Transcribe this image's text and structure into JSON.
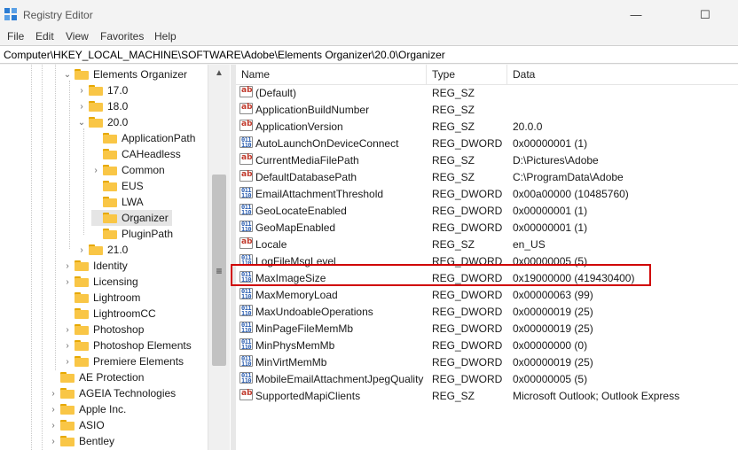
{
  "window": {
    "title": "Registry Editor",
    "controls": [
      "—",
      "☐"
    ]
  },
  "menu": [
    "File",
    "Edit",
    "View",
    "Favorites",
    "Help"
  ],
  "address": "Computer\\HKEY_LOCAL_MACHINE\\SOFTWARE\\Adobe\\Elements Organizer\\20.0\\Organizer",
  "tree": [
    {
      "label": "Elements Organizer",
      "chevron": "⌄"
    },
    {
      "label": "17.0",
      "chevron": "›"
    },
    {
      "label": "18.0",
      "chevron": "›"
    },
    {
      "label": "20.0",
      "chevron": "⌄"
    },
    {
      "label": "ApplicationPath",
      "chevron": ""
    },
    {
      "label": "CAHeadless",
      "chevron": ""
    },
    {
      "label": "Common",
      "chevron": "›"
    },
    {
      "label": "EUS",
      "chevron": ""
    },
    {
      "label": "LWA",
      "chevron": ""
    },
    {
      "label": "Organizer",
      "chevron": ""
    },
    {
      "label": "PluginPath",
      "chevron": ""
    },
    {
      "label": "21.0",
      "chevron": "›"
    },
    {
      "label": "Identity",
      "chevron": "›"
    },
    {
      "label": "Licensing",
      "chevron": "›"
    },
    {
      "label": "Lightroom",
      "chevron": ""
    },
    {
      "label": "LightroomCC",
      "chevron": ""
    },
    {
      "label": "Photoshop",
      "chevron": "›"
    },
    {
      "label": "Photoshop Elements",
      "chevron": "›"
    },
    {
      "label": "Premiere Elements",
      "chevron": "›"
    },
    {
      "label": "AE Protection",
      "chevron": ""
    },
    {
      "label": "AGEIA Technologies",
      "chevron": "›"
    },
    {
      "label": "Apple Inc.",
      "chevron": "›"
    },
    {
      "label": "ASIO",
      "chevron": "›"
    },
    {
      "label": "Bentley",
      "chevron": "›"
    }
  ],
  "scrollbar": {
    "up_arrow": "▲",
    "grip": "≡"
  },
  "columns": {
    "name": "Name",
    "type": "Type",
    "data": "Data"
  },
  "values": [
    {
      "name": "(Default)",
      "type": "REG_SZ",
      "data": "",
      "icon": "string-value-icon"
    },
    {
      "name": "ApplicationBuildNumber",
      "type": "REG_SZ",
      "data": "",
      "icon": "string-value-icon"
    },
    {
      "name": "ApplicationVersion",
      "type": "REG_SZ",
      "data": "20.0.0",
      "icon": "string-value-icon"
    },
    {
      "name": "AutoLaunchOnDeviceConnect",
      "type": "REG_DWORD",
      "data": "0x00000001 (1)",
      "icon": "binary-value-icon"
    },
    {
      "name": "CurrentMediaFilePath",
      "type": "REG_SZ",
      "data": "D:\\Pictures\\Adobe",
      "icon": "string-value-icon"
    },
    {
      "name": "DefaultDatabasePath",
      "type": "REG_SZ",
      "data": "C:\\ProgramData\\Adobe",
      "icon": "string-value-icon"
    },
    {
      "name": "EmailAttachmentThreshold",
      "type": "REG_DWORD",
      "data": "0x00a00000 (10485760)",
      "icon": "binary-value-icon"
    },
    {
      "name": "GeoLocateEnabled",
      "type": "REG_DWORD",
      "data": "0x00000001 (1)",
      "icon": "binary-value-icon"
    },
    {
      "name": "GeoMapEnabled",
      "type": "REG_DWORD",
      "data": "0x00000001 (1)",
      "icon": "binary-value-icon"
    },
    {
      "name": "Locale",
      "type": "REG_SZ",
      "data": "en_US",
      "icon": "string-value-icon"
    },
    {
      "name": "LogFileMsgLevel",
      "type": "REG_DWORD",
      "data": "0x00000005 (5)",
      "icon": "binary-value-icon"
    },
    {
      "name": "MaxImageSize",
      "type": "REG_DWORD",
      "data": "0x19000000 (419430400)",
      "icon": "binary-value-icon"
    },
    {
      "name": "MaxMemoryLoad",
      "type": "REG_DWORD",
      "data": "0x00000063 (99)",
      "icon": "binary-value-icon"
    },
    {
      "name": "MaxUndoableOperations",
      "type": "REG_DWORD",
      "data": "0x00000019 (25)",
      "icon": "binary-value-icon"
    },
    {
      "name": "MinPageFileMemMb",
      "type": "REG_DWORD",
      "data": "0x00000019 (25)",
      "icon": "binary-value-icon"
    },
    {
      "name": "MinPhysMemMb",
      "type": "REG_DWORD",
      "data": "0x00000000 (0)",
      "icon": "binary-value-icon"
    },
    {
      "name": "MinVirtMemMb",
      "type": "REG_DWORD",
      "data": "0x00000019 (25)",
      "icon": "binary-value-icon"
    },
    {
      "name": "MobileEmailAttachmentJpegQuality",
      "type": "REG_DWORD",
      "data": "0x00000005 (5)",
      "icon": "binary-value-icon"
    },
    {
      "name": "SupportedMapiClients",
      "type": "REG_SZ",
      "data": "Microsoft Outlook; Outlook Express",
      "icon": "string-value-icon"
    }
  ],
  "colors": {
    "highlight": "#d00000",
    "folder": "#f9c646",
    "selection": "#e5e5e5"
  }
}
